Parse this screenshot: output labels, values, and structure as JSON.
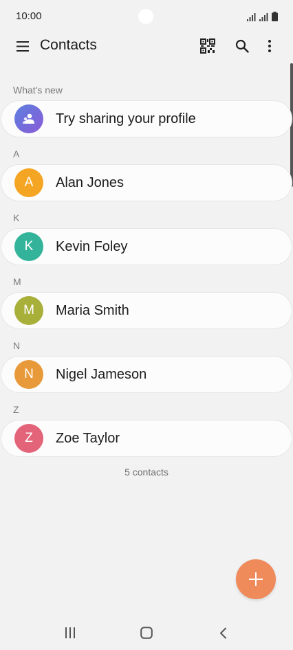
{
  "status_bar": {
    "time": "10:00"
  },
  "header": {
    "title": "Contacts"
  },
  "icons": {
    "menu": "menu-icon",
    "qr": "qr-code-icon",
    "search": "search-icon",
    "more": "more-options-icon",
    "fab": "plus-icon"
  },
  "whats_new": {
    "header": "What's new",
    "label": "Try sharing your profile"
  },
  "sections": [
    {
      "letter": "A",
      "initial": "A",
      "name": "Alan Jones",
      "color": "#f5a524"
    },
    {
      "letter": "K",
      "initial": "K",
      "name": "Kevin Foley",
      "color": "#33b39a"
    },
    {
      "letter": "M",
      "initial": "M",
      "name": "Maria Smith",
      "color": "#a8b03a"
    },
    {
      "letter": "N",
      "initial": "N",
      "name": "Nigel Jameson",
      "color": "#e89a3a"
    },
    {
      "letter": "Z",
      "initial": "Z",
      "name": "Zoe Taylor",
      "color": "#e36478"
    }
  ],
  "footer": {
    "count": "5 contacts"
  },
  "colors": {
    "fab": "#ef8a5a",
    "background": "#f2f2f2",
    "profile_avatar": "#6a6bd6"
  }
}
